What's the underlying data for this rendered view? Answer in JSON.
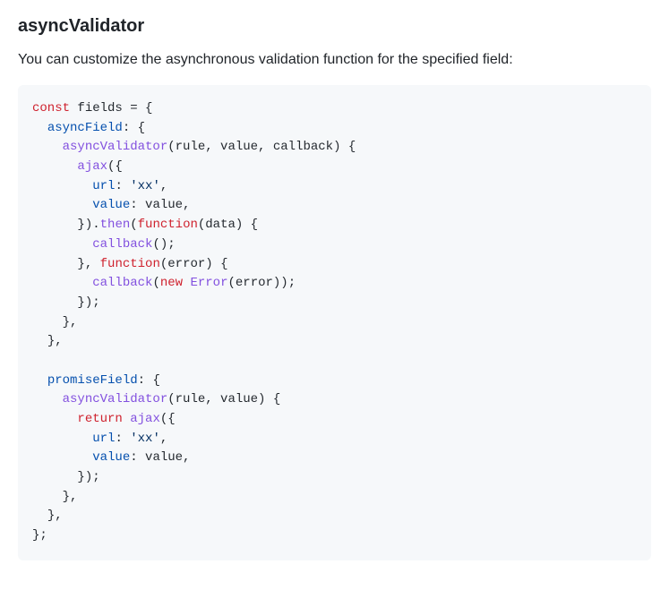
{
  "heading": "asyncValidator",
  "description": "You can customize the asynchronous validation function for the specified field:",
  "code": {
    "l1": {
      "kw": "const",
      "name": "fields",
      "eq": " = {"
    },
    "l2": {
      "prop": "asyncField",
      "tail": ": {"
    },
    "l3": {
      "fn": "asyncValidator",
      "args": "(rule, value, callback) {"
    },
    "l4": {
      "callee": "ajax",
      "tail": "({"
    },
    "l5": {
      "prop": "url",
      "colon": ": ",
      "str": "'xx'",
      "tail": ","
    },
    "l6": {
      "prop": "value",
      "tail": ": value,"
    },
    "l7": {
      "close": "}).",
      "then": "then",
      "open": "(",
      "kw": "function",
      "args": "(data) {"
    },
    "l8": {
      "call": "callback",
      "tail": "();"
    },
    "l9": {
      "close": "}, ",
      "kw": "function",
      "args": "(error) {"
    },
    "l10": {
      "call": "callback",
      "open": "(",
      "kw": "new",
      "sp": " ",
      "err": "Error",
      "args": "(error));"
    },
    "l11": {
      "txt": "});"
    },
    "l12": {
      "txt": "},"
    },
    "l13": {
      "txt": "},"
    },
    "blank": "",
    "l15": {
      "prop": "promiseField",
      "tail": ": {"
    },
    "l16": {
      "fn": "asyncValidator",
      "args": "(rule, value) {"
    },
    "l17": {
      "kw": "return",
      "sp": " ",
      "callee": "ajax",
      "tail": "({"
    },
    "l18": {
      "prop": "url",
      "colon": ": ",
      "str": "'xx'",
      "tail": ","
    },
    "l19": {
      "prop": "value",
      "tail": ": value,"
    },
    "l20": {
      "txt": "});"
    },
    "l21": {
      "txt": "},"
    },
    "l22": {
      "txt": "},"
    },
    "l23": {
      "txt": "};"
    }
  }
}
